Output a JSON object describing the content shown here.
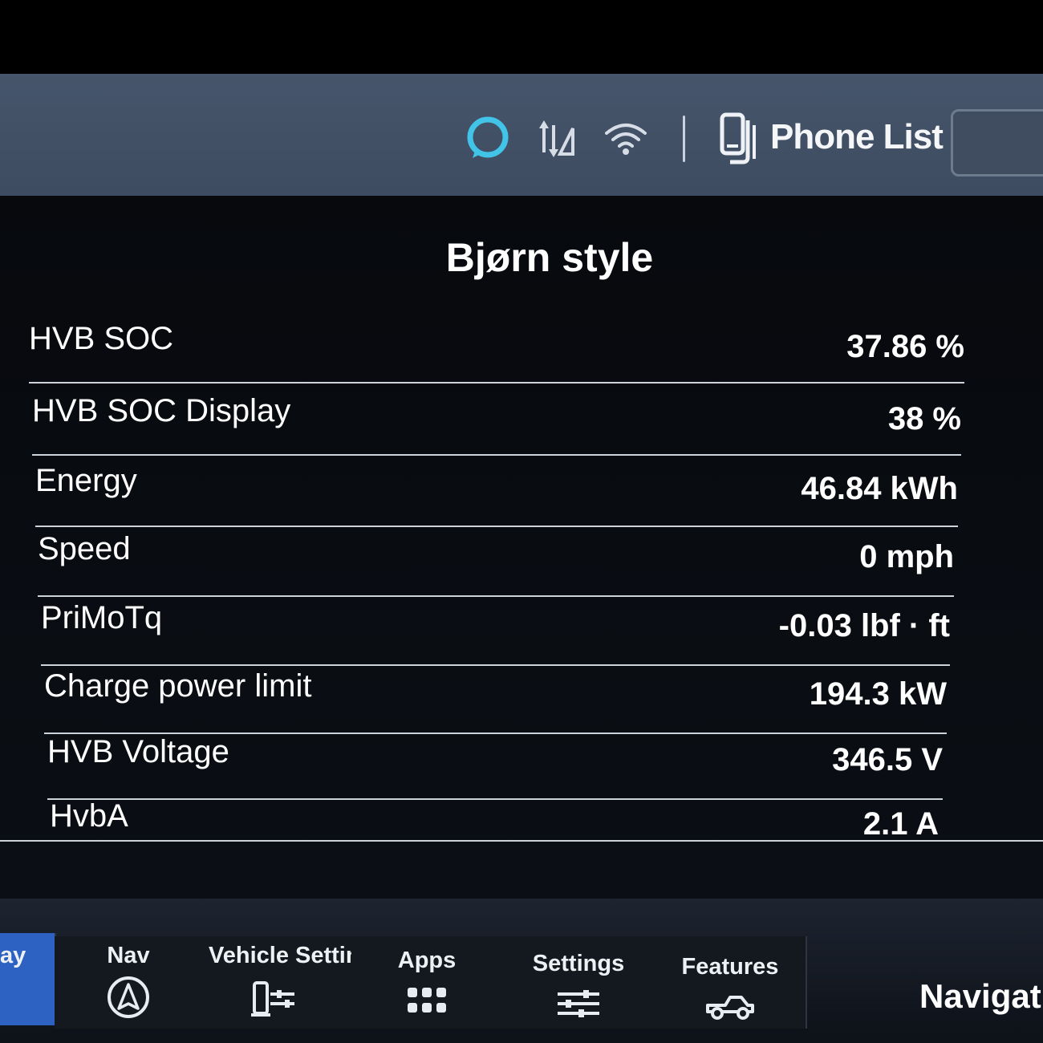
{
  "status_bar": {
    "icons": [
      "alexa-ring-icon",
      "data-arrows-icon",
      "wifi-icon",
      "phone-icon"
    ],
    "phone_label": "Phone List",
    "alexa_color": "#41c4e8"
  },
  "main": {
    "title": "Bjørn style",
    "rows": [
      {
        "label": "HVB SOC",
        "value": "37.86 %"
      },
      {
        "label": "HVB SOC Display",
        "value": "38 %"
      },
      {
        "label": "Energy",
        "value": "46.84 kWh"
      },
      {
        "label": "Speed",
        "value": "0 mph"
      },
      {
        "label": "PriMoTq",
        "value": "-0.03 lbf · ft"
      },
      {
        "label": "Charge power limit",
        "value": "194.3 kW"
      },
      {
        "label": "HVB Voltage",
        "value": "346.5 V"
      },
      {
        "label": "HvbA",
        "value": "2.1 A"
      }
    ]
  },
  "nav_bar": {
    "active_color": "#2d62c2",
    "tabs": [
      {
        "label": "ay",
        "icon": ""
      },
      {
        "label": "Nav",
        "icon": "nav-compass-icon"
      },
      {
        "label": "Vehicle Settin",
        "icon": "vehicle-settings-icon"
      },
      {
        "label": "Apps",
        "icon": "apps-grid-icon"
      },
      {
        "label": "Settings",
        "icon": "settings-sliders-icon"
      },
      {
        "label": "Features",
        "icon": "truck-icon"
      }
    ],
    "extra_label": "Navigati"
  }
}
